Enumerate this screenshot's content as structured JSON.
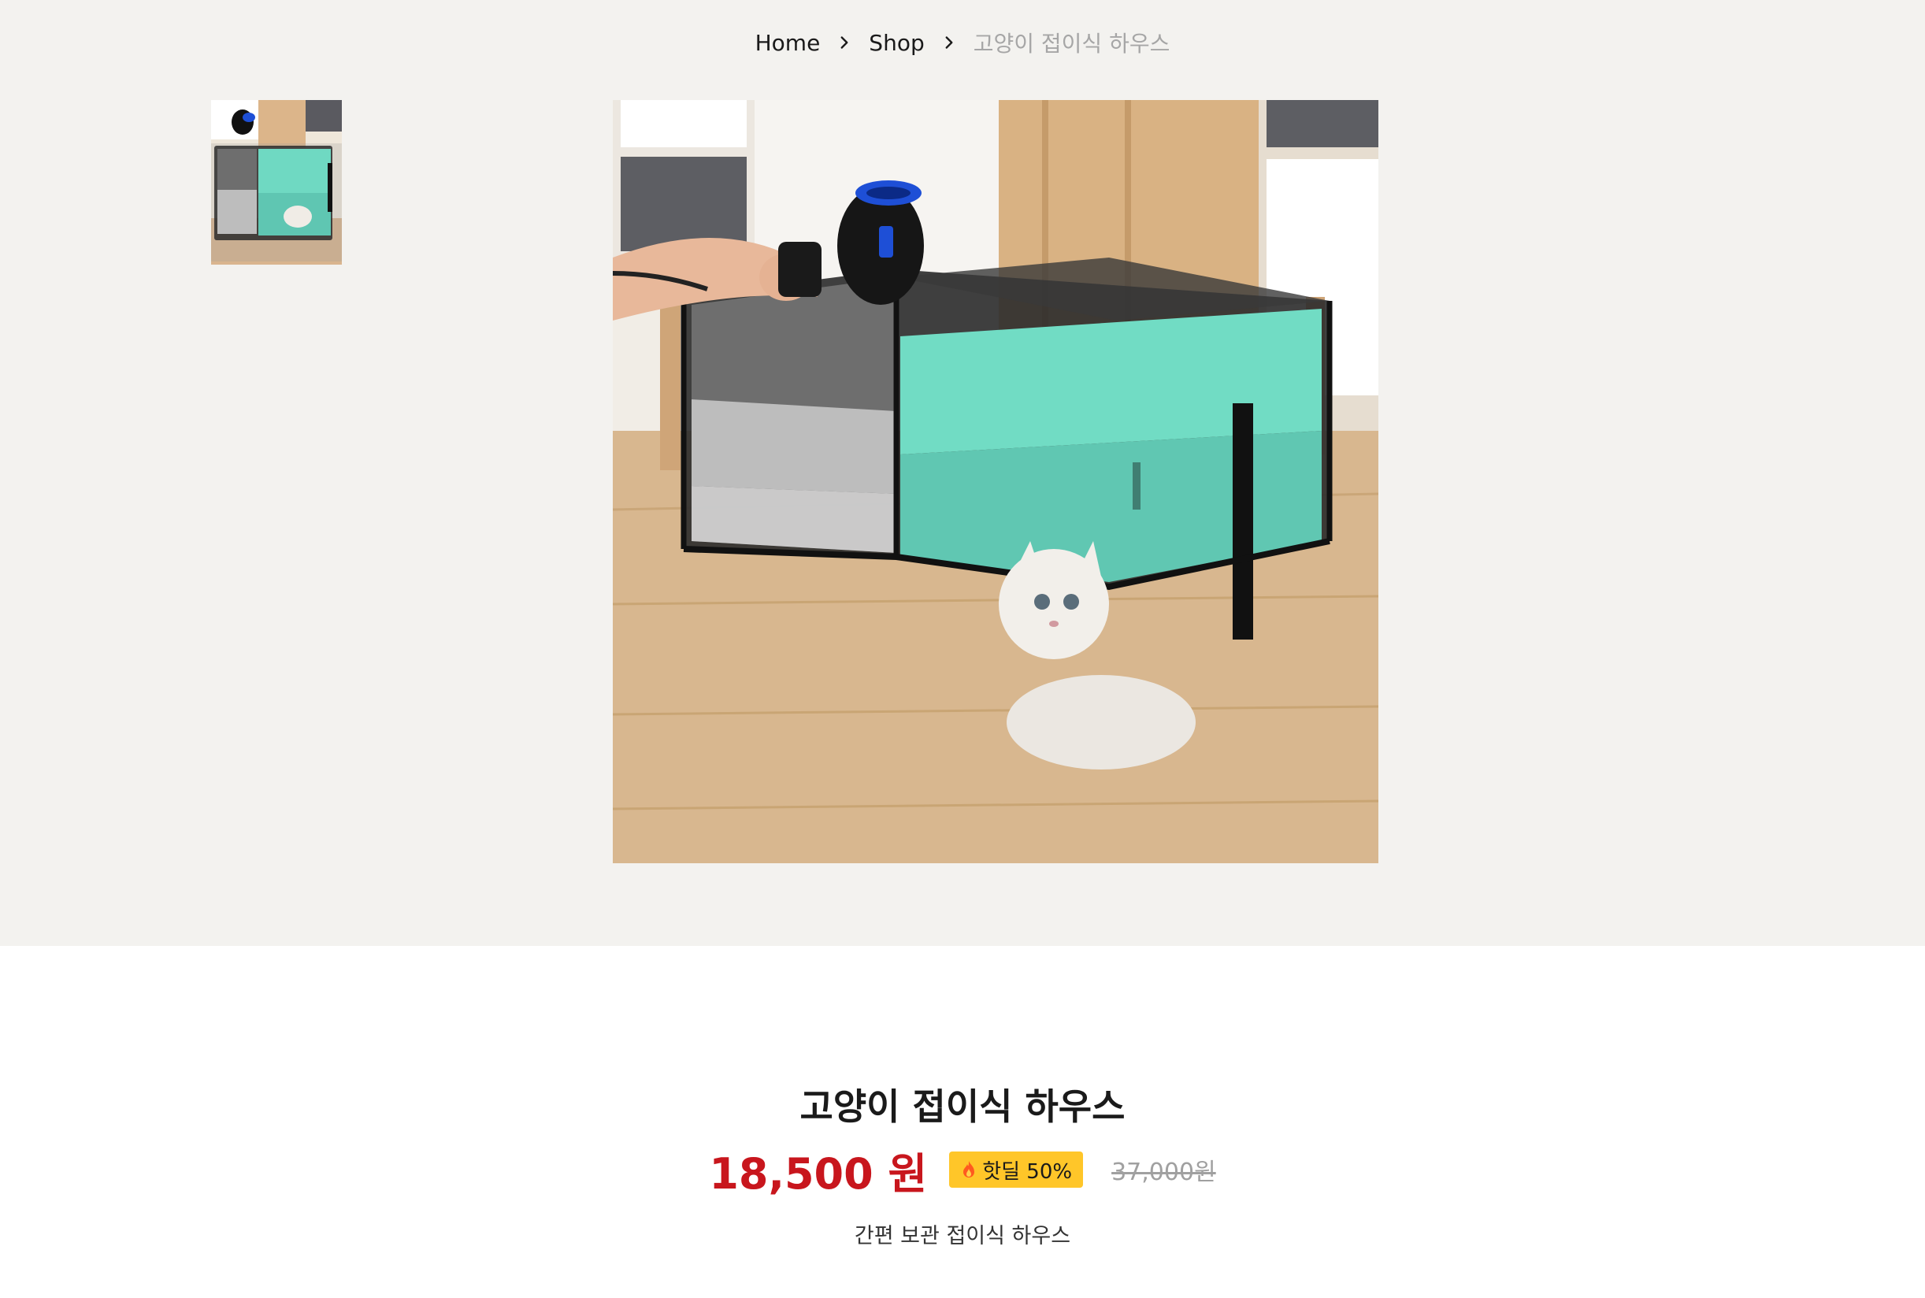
{
  "breadcrumb": {
    "items": [
      {
        "label": "Home"
      },
      {
        "label": "Shop"
      }
    ],
    "current": "고양이 접이식 하우스"
  },
  "gallery": {
    "thumbnail_icon": "product-thumbnail",
    "main_image_icon": "product-photo-cat-playpen"
  },
  "product": {
    "title": "고양이 접이식 하우스",
    "price": "18,500 원",
    "deal_badge": "핫딜 50%",
    "deal_icon": "flame-icon",
    "original_price": "37,000원",
    "subtitle": "간편 보관 접이식 하우스"
  },
  "colors": {
    "top_background": "#f3f2ef",
    "price": "#c8161d",
    "badge": "#ffc629",
    "muted": "#a6a6a6"
  }
}
